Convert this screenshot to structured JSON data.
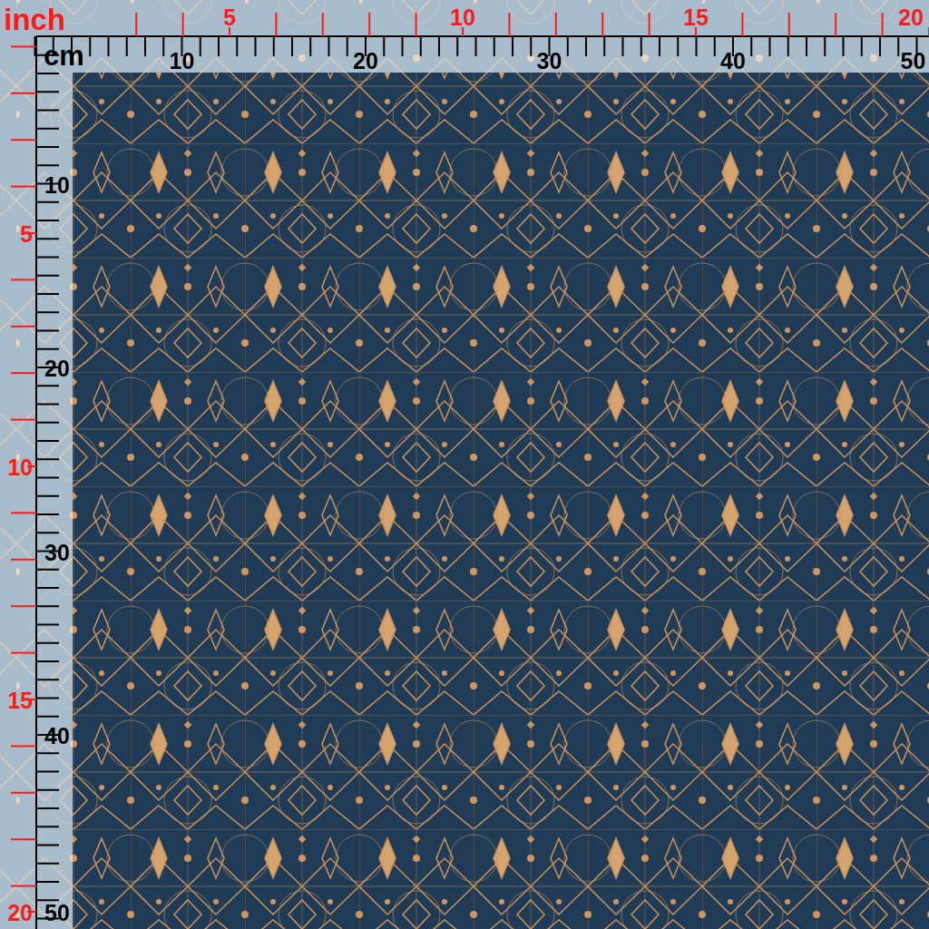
{
  "units": {
    "inch_label": "inch",
    "cm_label": "cm"
  },
  "top_ruler": {
    "cm_labels": [
      "10",
      "20",
      "30",
      "40",
      "50"
    ],
    "inch_labels": [
      "5",
      "10",
      "15",
      "20"
    ]
  },
  "left_ruler": {
    "cm_labels": [
      "10",
      "20",
      "30",
      "40",
      "50"
    ],
    "inch_labels": [
      "5",
      "10",
      "15",
      "20"
    ]
  }
}
